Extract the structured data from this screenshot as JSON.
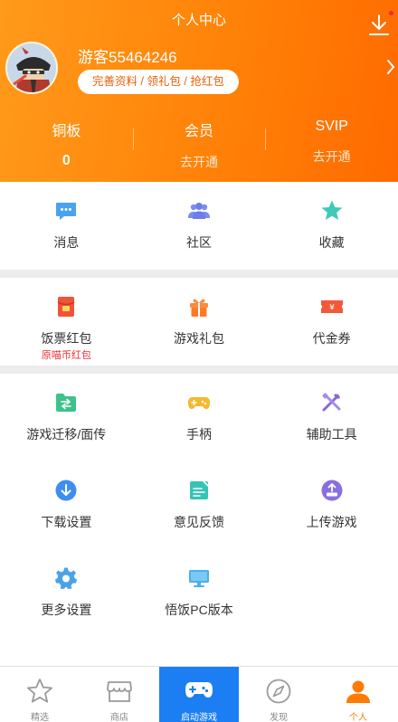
{
  "header": {
    "title": "个人中心",
    "username": "游客55464246",
    "profile_pill": "完善资料 / 领礼包 / 抢红包"
  },
  "stats": [
    {
      "label": "铜板",
      "value": "0"
    },
    {
      "label": "会员",
      "value": "去开通"
    },
    {
      "label": "SVIP",
      "value": "去开通"
    }
  ],
  "section1": [
    {
      "label": "消息",
      "icon": "message-icon"
    },
    {
      "label": "社区",
      "icon": "community-icon"
    },
    {
      "label": "收藏",
      "icon": "star-icon"
    }
  ],
  "section2": [
    {
      "label": "饭票红包",
      "sub": "原喵币红包",
      "icon": "red-packet-icon"
    },
    {
      "label": "游戏礼包",
      "icon": "gift-icon"
    },
    {
      "label": "代金券",
      "icon": "voucher-icon"
    }
  ],
  "section3": [
    {
      "label": "游戏迁移/面传",
      "icon": "transfer-icon"
    },
    {
      "label": "手柄",
      "icon": "gamepad-icon"
    },
    {
      "label": "辅助工具",
      "icon": "tools-icon"
    },
    {
      "label": "下载设置",
      "icon": "download-settings-icon"
    },
    {
      "label": "意见反馈",
      "icon": "feedback-icon"
    },
    {
      "label": "上传游戏",
      "icon": "upload-icon"
    },
    {
      "label": "更多设置",
      "icon": "settings-gear-icon"
    },
    {
      "label": "悟饭PC版本",
      "icon": "pc-monitor-icon"
    }
  ],
  "tabbar": [
    {
      "label": "精选",
      "icon": "star-outline-icon"
    },
    {
      "label": "商店",
      "icon": "store-icon"
    },
    {
      "label": "启动游戏",
      "icon": "gamepad-launch-icon"
    },
    {
      "label": "发现",
      "icon": "compass-icon"
    },
    {
      "label": "个人",
      "icon": "person-icon"
    }
  ],
  "colors": {
    "header_orange": "#ff8208",
    "accent_blue": "#1b7ef2",
    "red_text": "#e8303a"
  }
}
